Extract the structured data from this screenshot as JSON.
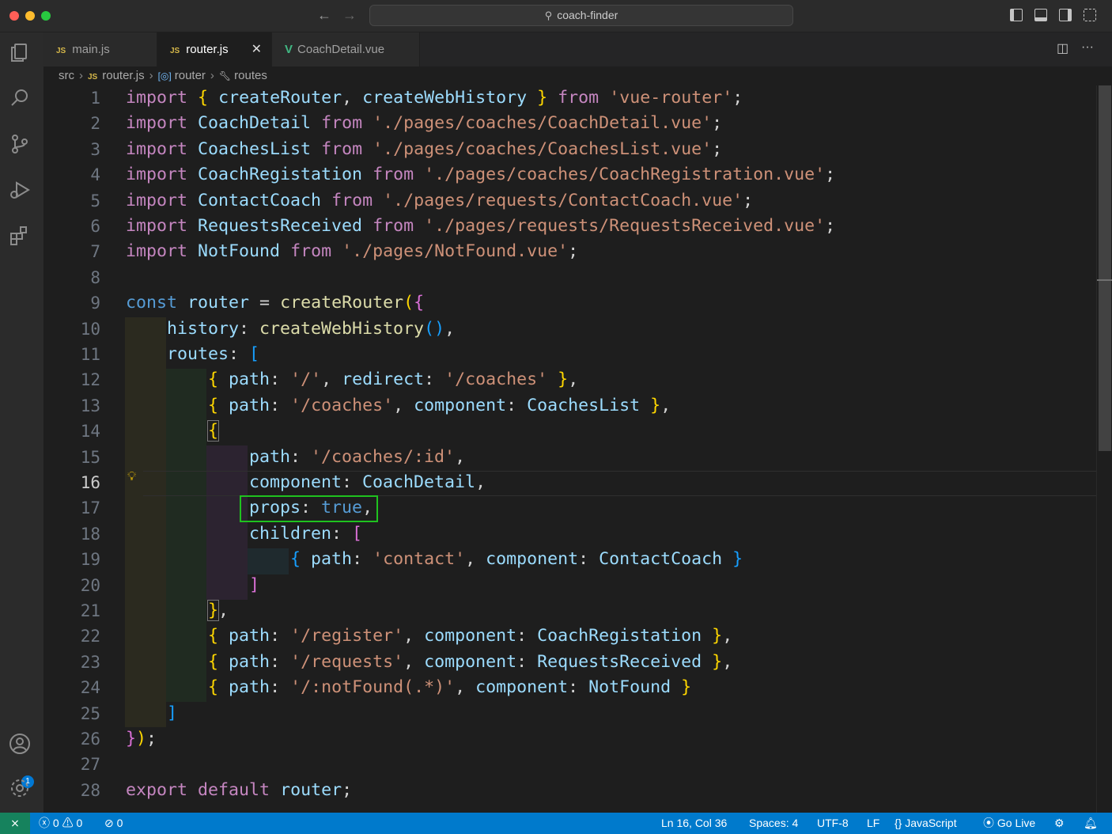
{
  "window": {
    "title": "coach-finder"
  },
  "tabs": [
    {
      "label": "main.js",
      "icon": "JS",
      "active": false
    },
    {
      "label": "router.js",
      "icon": "JS",
      "active": true
    },
    {
      "label": "CoachDetail.vue",
      "icon": "V",
      "active": false
    }
  ],
  "breadcrumb": {
    "folder": "src",
    "file": "router.js",
    "symbol1": "router",
    "symbol2": "routes"
  },
  "editor": {
    "current_line": 16,
    "line_numbers": [
      "1",
      "2",
      "3",
      "4",
      "5",
      "6",
      "7",
      "8",
      "9",
      "10",
      "11",
      "12",
      "13",
      "14",
      "15",
      "16",
      "17",
      "18",
      "19",
      "20",
      "21",
      "22",
      "23",
      "24",
      "25",
      "26",
      "27",
      "28"
    ]
  },
  "statusbar": {
    "errors": "0",
    "warnings": "0",
    "ports": "0",
    "cursor": "Ln 16, Col 36",
    "spaces": "Spaces: 4",
    "encoding": "UTF-8",
    "eol": "LF",
    "language": "JavaScript",
    "golive": "Go Live"
  },
  "accounts_badge": "1",
  "colors": {
    "statusbar": "#007acc",
    "highlight_box": "#1fc21f",
    "accent": "#0078d4"
  }
}
